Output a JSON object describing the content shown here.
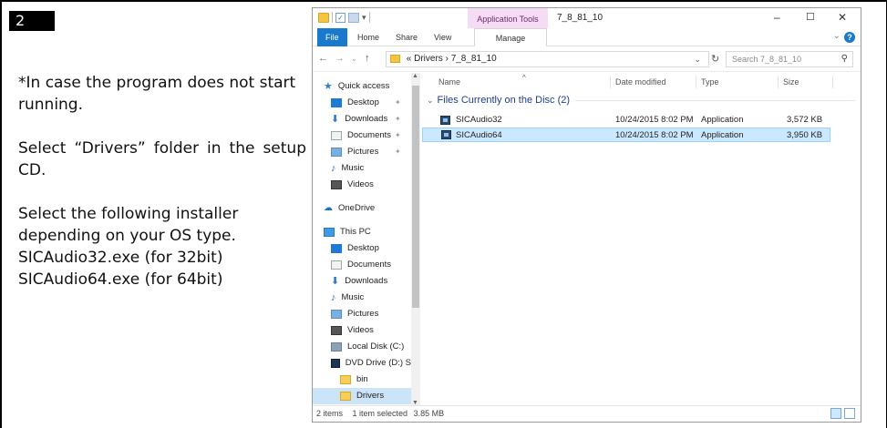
{
  "step": {
    "number": "2"
  },
  "instructions": {
    "note": "*In case the program does not start running.",
    "select_folder": "Select “Drivers” folder in the setup CD.",
    "select_installer": "Select the following installer depending on your OS type.",
    "exe32": "SICAudio32.exe (for 32bit)",
    "exe64": "SICAudio64.exe (for 64bit)"
  },
  "window": {
    "title": "7_8_81_10",
    "app_tools": "Application Tools",
    "ribbon_tabs": [
      "File",
      "Home",
      "Share",
      "View",
      "Manage"
    ],
    "address": {
      "prefix": "«",
      "path": [
        "Drivers",
        "7_8_81_10"
      ]
    },
    "search_placeholder": "Search 7_8_81_10",
    "nav": [
      {
        "label": "Quick access"
      },
      {
        "label": "Desktop"
      },
      {
        "label": "Downloads"
      },
      {
        "label": "Documents"
      },
      {
        "label": "Pictures"
      },
      {
        "label": "Music"
      },
      {
        "label": "Videos"
      },
      {
        "label": "OneDrive"
      },
      {
        "label": "This PC"
      },
      {
        "label": "Desktop"
      },
      {
        "label": "Documents"
      },
      {
        "label": "Downloads"
      },
      {
        "label": "Music"
      },
      {
        "label": "Pictures"
      },
      {
        "label": "Videos"
      },
      {
        "label": "Local Disk (C:)"
      },
      {
        "label": "DVD Drive (D:) S"
      },
      {
        "label": "bin"
      },
      {
        "label": "Drivers"
      }
    ],
    "columns": [
      "Name",
      "Date modified",
      "Type",
      "Size"
    ],
    "group_label": "Files Currently on the Disc (2)",
    "files": [
      {
        "name": "SICAudio32",
        "date": "10/24/2015 8:02 PM",
        "type": "Application",
        "size": "3,572 KB"
      },
      {
        "name": "SICAudio64",
        "date": "10/24/2015 8:02 PM",
        "type": "Application",
        "size": "3,950 KB"
      }
    ],
    "status": {
      "count": "2 items",
      "selected": "1 item selected",
      "size": "3.85 MB"
    }
  }
}
